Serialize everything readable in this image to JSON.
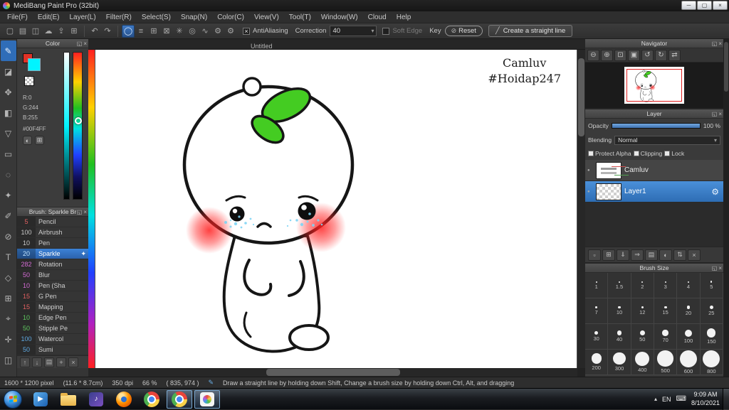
{
  "colors": {
    "accent": "#2e72c8",
    "selection": "#2f7fd6"
  },
  "titlebar": {
    "title": "MediBang Paint Pro (32bit)",
    "minimize_glyph": "─",
    "maximize_glyph": "▢",
    "close_glyph": "×"
  },
  "menubar": {
    "items": [
      "File(F)",
      "Edit(E)",
      "Layer(L)",
      "Filter(R)",
      "Select(S)",
      "Snap(N)",
      "Color(C)",
      "View(V)",
      "Tool(T)",
      "Window(W)",
      "Cloud",
      "Help"
    ]
  },
  "toolbar": {
    "file_icons": [
      {
        "name": "new-file-icon",
        "glyph": "▢"
      },
      {
        "name": "open-file-icon",
        "glyph": "▤"
      },
      {
        "name": "save-file-icon",
        "glyph": "◫"
      },
      {
        "name": "cloud-save-icon",
        "glyph": "☁"
      },
      {
        "name": "export-icon",
        "glyph": "⇪"
      },
      {
        "name": "publish-icon",
        "glyph": "⊞"
      }
    ],
    "history_icons": [
      {
        "name": "undo-icon",
        "glyph": "↶"
      },
      {
        "name": "redo-icon",
        "glyph": "↷"
      }
    ],
    "snap_icons": [
      {
        "name": "snap-off-icon",
        "glyph": "◯",
        "selected": true
      },
      {
        "name": "snap-parallel-icon",
        "glyph": "≡"
      },
      {
        "name": "snap-crisscross-icon",
        "glyph": "⊞"
      },
      {
        "name": "snap-vanishing-icon",
        "glyph": "⊠"
      },
      {
        "name": "snap-radial-icon",
        "glyph": "✳"
      },
      {
        "name": "snap-concentric-icon",
        "glyph": "◎"
      },
      {
        "name": "snap-curve-icon",
        "glyph": "∿"
      },
      {
        "name": "snap-settings-icon",
        "glyph": "⚙"
      },
      {
        "name": "snap-option-icon",
        "glyph": "⚙"
      }
    ],
    "antialiasing_label": "AntiAliasing",
    "antialiasing_checked_glyph": "×",
    "correction_label": "Correction",
    "correction_value": "40",
    "soft_edge_label": "Soft Edge",
    "key_label": "Key",
    "reset_label": "Reset",
    "straight_line_label": "Create a straight line"
  },
  "tools": {
    "items": [
      {
        "name": "brush-tool-icon",
        "glyph": "✎",
        "selected": true
      },
      {
        "name": "eraser-tool-icon",
        "glyph": "◪"
      },
      {
        "name": "move-tool-icon",
        "glyph": "✥"
      },
      {
        "name": "fill-tool-icon",
        "glyph": "◧"
      },
      {
        "name": "gradient-tool-icon",
        "glyph": "▽"
      },
      {
        "name": "select-tool-icon",
        "glyph": "▭"
      },
      {
        "name": "lasso-tool-icon",
        "glyph": "◌"
      },
      {
        "name": "magic-wand-tool-icon",
        "glyph": "✦"
      },
      {
        "name": "select-pen-tool-icon",
        "glyph": "✐"
      },
      {
        "name": "select-eraser-tool-icon",
        "glyph": "⊘"
      },
      {
        "name": "text-tool-icon",
        "glyph": "T"
      },
      {
        "name": "shape-tool-icon",
        "glyph": "◇"
      },
      {
        "name": "divide-tool-icon",
        "glyph": "⊞"
      },
      {
        "name": "eyedropper-tool-icon",
        "glyph": "⌖"
      },
      {
        "name": "hand-tool-icon",
        "glyph": "✛"
      },
      {
        "name": "panel-toggle-icon",
        "glyph": "◫"
      }
    ]
  },
  "color_panel": {
    "title": "Color",
    "rgb": [
      "R:0",
      "G:244",
      "B:255"
    ],
    "hex": "#00F4FF",
    "mode_icons": [
      {
        "name": "color-wheel-icon",
        "glyph": "◐"
      },
      {
        "name": "color-grid-icon",
        "glyph": "⊞"
      }
    ]
  },
  "brush_panel": {
    "title": "Brush: Sparkle Br",
    "brushes": [
      {
        "size": "5",
        "name": "Pencil",
        "color": "#e06060"
      },
      {
        "size": "100",
        "name": "Airbrush",
        "color": "#c8c8c8"
      },
      {
        "size": "10",
        "name": "Pen",
        "color": "#c8c8c8"
      },
      {
        "size": "20",
        "name": "Sparkle",
        "color": "#bfe3ff",
        "selected": true
      },
      {
        "size": "282",
        "name": "Rotation",
        "color": "#d36bd3"
      },
      {
        "size": "50",
        "name": "Blur",
        "color": "#d36bd3"
      },
      {
        "size": "10",
        "name": "Pen (Sha",
        "color": "#d36bd3"
      },
      {
        "size": "15",
        "name": "G Pen",
        "color": "#e06060"
      },
      {
        "size": "15",
        "name": "Mapping",
        "color": "#e06060"
      },
      {
        "size": "10",
        "name": "Edge Pen",
        "color": "#5fc75f"
      },
      {
        "size": "50",
        "name": "Stipple Pe",
        "color": "#5fc75f"
      },
      {
        "size": "100",
        "name": "Watercol",
        "color": "#5fa8e0"
      },
      {
        "size": "50",
        "name": "Sumi",
        "color": "#5fa8e0"
      }
    ],
    "selected_gear_glyph": "✦",
    "footer_icons": [
      {
        "name": "brush-prev-icon",
        "glyph": "↑"
      },
      {
        "name": "brush-next-icon",
        "glyph": "↓"
      },
      {
        "name": "brush-folder-icon",
        "glyph": "▤"
      },
      {
        "name": "add-brush-icon",
        "glyph": "+"
      },
      {
        "name": "delete-brush-icon",
        "glyph": "×"
      }
    ]
  },
  "canvas": {
    "tab": "Untitled",
    "signature_line1": "Camluv",
    "signature_line2": "#Hoidap247",
    "character": {
      "leaf": "#44cc22",
      "blush": "#ff2020",
      "tear": "#7fd4f4",
      "outline": "#161616",
      "eye": "#0e0e0e"
    }
  },
  "navigator": {
    "title": "Navigator",
    "icons": [
      {
        "name": "zoom-out-icon",
        "glyph": "⊖"
      },
      {
        "name": "zoom-in-icon",
        "glyph": "⊕"
      },
      {
        "name": "zoom-fit-icon",
        "glyph": "⊡"
      },
      {
        "name": "zoom-actual-icon",
        "glyph": "▣"
      },
      {
        "name": "rotate-left-icon",
        "glyph": "↺"
      },
      {
        "name": "rotate-right-icon",
        "glyph": "↻"
      },
      {
        "name": "rotate-reset-icon",
        "glyph": "⇄"
      }
    ]
  },
  "layer_panel": {
    "title": "Layer",
    "opacity_label": "Opacity",
    "opacity_value": "100 %",
    "blending_label": "Blending",
    "blending_value": "Normal",
    "checks": [
      "Protect Alpha",
      "Clipping",
      "Lock"
    ],
    "layers": [
      {
        "name": "Camluv",
        "checker": false,
        "selected": false
      },
      {
        "name": "Layer1",
        "checker": true,
        "selected": true
      }
    ],
    "gear_glyph": "⚙",
    "visibility_glyph": "●",
    "toolbar_icons": [
      {
        "name": "new-layer-icon",
        "glyph": "▫"
      },
      {
        "name": "duplicate-layer-icon",
        "glyph": "⊞"
      },
      {
        "name": "merge-down-icon",
        "glyph": "⇓"
      },
      {
        "name": "transfer-layer-icon",
        "glyph": "⇒"
      },
      {
        "name": "layer-folder-icon",
        "glyph": "▤"
      },
      {
        "name": "layer-mask-icon",
        "glyph": "◐"
      },
      {
        "name": "layer-order-icon",
        "glyph": "⇅"
      },
      {
        "name": "delete-layer-icon",
        "glyph": "×"
      }
    ]
  },
  "brush_size_panel": {
    "title": "Brush Size",
    "sizes": [
      "1",
      "1.5",
      "2",
      "3",
      "4",
      "5",
      "7",
      "10",
      "12",
      "15",
      "20",
      "25",
      "30",
      "40",
      "50",
      "70",
      "100",
      "150",
      "200",
      "300",
      "400",
      "500",
      "600",
      "800"
    ]
  },
  "statusbar": {
    "dimensions": "1600 * 1200 pixel",
    "physical": "(11.6 * 8.7cm)",
    "dpi": "350 dpi",
    "zoom": "66 %",
    "coords": "( 835, 974 )",
    "hint": "Draw a straight line by holding down Shift, Change a brush size by holding down Ctrl, Alt, and dragging"
  },
  "taskbar": {
    "tray": {
      "expand": "▴",
      "lang": "EN",
      "time": "9:09 AM",
      "date": "8/10/2021"
    }
  }
}
